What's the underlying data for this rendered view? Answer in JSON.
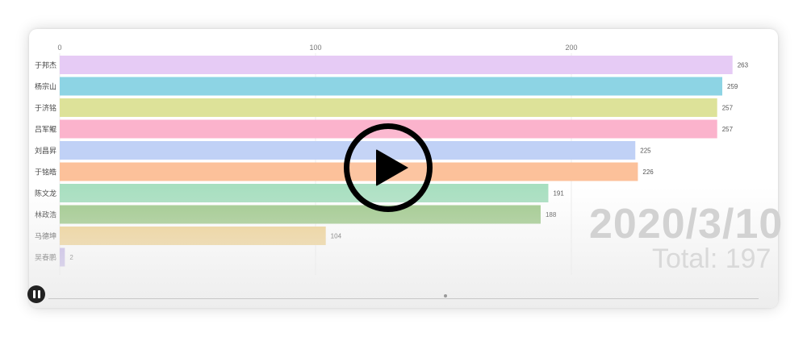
{
  "chart_data": {
    "type": "bar",
    "orientation": "horizontal",
    "categories": [
      "于邦杰",
      "杨宗山",
      "于济铭",
      "吕军鲲",
      "刘昌昇",
      "于铭皓",
      "陈文龙",
      "林政浩",
      "马德坤",
      "吴春鹏"
    ],
    "values": [
      263,
      259,
      257,
      257,
      225,
      226,
      191,
      188,
      104,
      2
    ],
    "value_labels": [
      "263",
      "259",
      "257",
      "257",
      "225",
      "226",
      "191",
      "188",
      "104",
      "2"
    ],
    "xlim": [
      0,
      280
    ],
    "x_ticks": [
      0,
      100,
      200
    ],
    "x_tick_labels": [
      "0",
      "100",
      "200"
    ],
    "colors": [
      "#e6cbf5",
      "#8dd4e4",
      "#dde299",
      "#fbb3cc",
      "#c0d1f6",
      "#fcc19a",
      "#a8dfc0",
      "#9fc98b",
      "#efd08d",
      "#bdaee6"
    ],
    "grid": true,
    "date_label": "2020/3/10",
    "total_label": "Total: 197"
  },
  "controls": {
    "play_icon": "play-icon",
    "pause_icon": "pause-icon"
  }
}
